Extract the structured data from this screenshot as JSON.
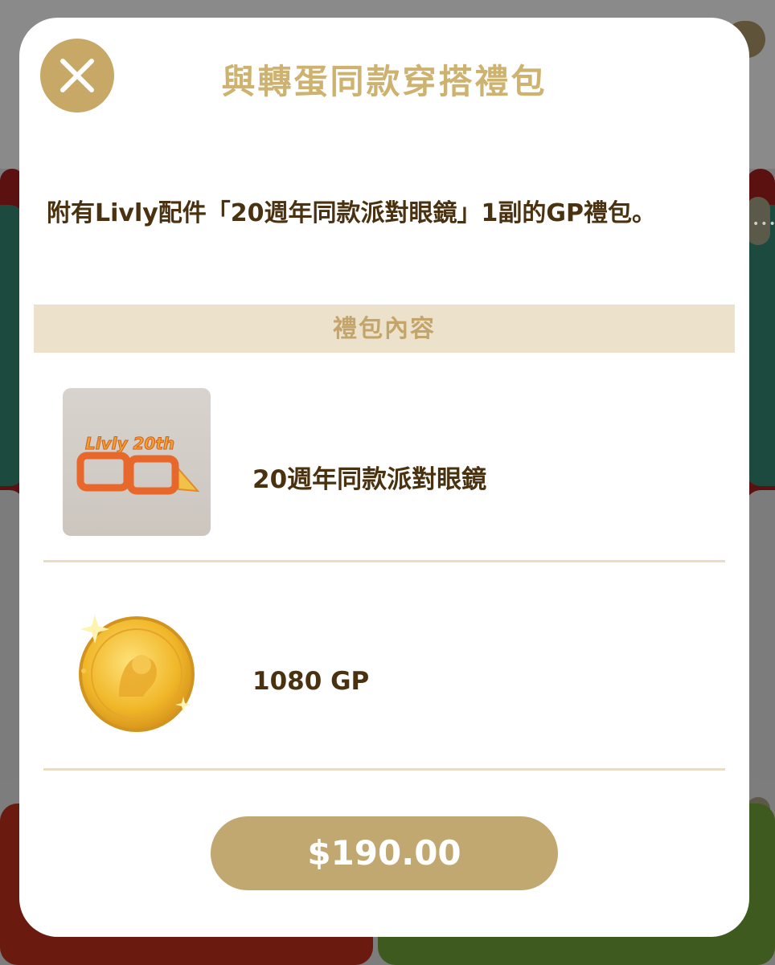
{
  "modal": {
    "title": "與轉蛋同款穿搭禮包",
    "description": "附有Livly配件「20週年同款派對眼鏡」1副的GP禮包。",
    "section_header": "禮包內容",
    "items": [
      {
        "name": "20週年同款派對眼鏡",
        "icon": "party-glasses-icon",
        "badge_text": "Livly 20th"
      },
      {
        "name": "1080 GP",
        "icon": "gold-coin-icon"
      }
    ],
    "price_label": "$190.00",
    "close_icon": "close-icon"
  },
  "colors": {
    "accent_gold": "#c7a866",
    "title_gold": "#cdb36f",
    "section_bg": "#ece2cc",
    "text_dark": "#4a3210",
    "price_button": "#c1a871"
  }
}
